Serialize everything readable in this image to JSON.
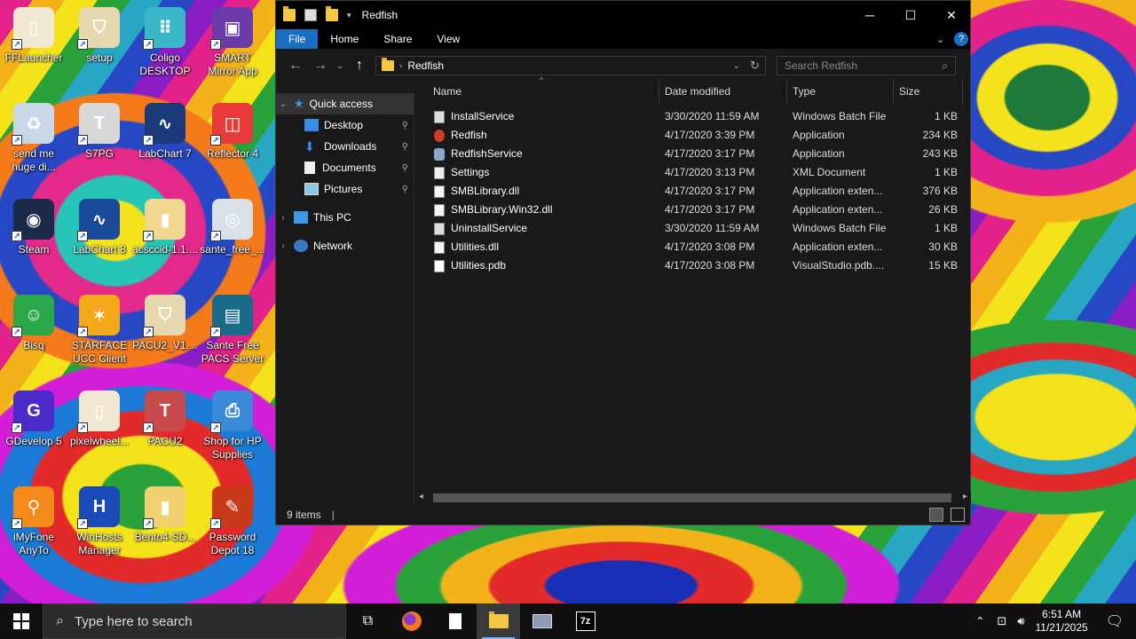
{
  "desktop": {
    "icons": [
      {
        "label": "FFLauncher",
        "color": "#f0e8d0",
        "glyph": "▯"
      },
      {
        "label": "setup",
        "color": "#e8d8b0",
        "glyph": "⛉"
      },
      {
        "label": "Coligo DESKTOP",
        "color": "#3ab8c8",
        "glyph": "⠿"
      },
      {
        "label": "SMART Mirror App",
        "color": "#6a3aa8",
        "glyph": "▣"
      },
      {
        "label": "send me huge di...",
        "color": "#c8d8e8",
        "glyph": "♻"
      },
      {
        "label": "S7PG",
        "color": "#d8d8d8",
        "glyph": "T"
      },
      {
        "label": "LabChart 7",
        "color": "#1a3a7a",
        "glyph": "∿"
      },
      {
        "label": "Reflector 4",
        "color": "#e83a3a",
        "glyph": "◫"
      },
      {
        "label": "Steam",
        "color": "#1a2a48",
        "glyph": "◉"
      },
      {
        "label": "LabChart 8",
        "color": "#1a4a9a",
        "glyph": "∿"
      },
      {
        "label": "acsccid-1.1....",
        "color": "#f0d890",
        "glyph": "▮"
      },
      {
        "label": "sante_free_...",
        "color": "#d8e0e8",
        "glyph": "◎"
      },
      {
        "label": "Bisq",
        "color": "#2aa84a",
        "glyph": "☺"
      },
      {
        "label": "STARFACE UCC Client",
        "color": "#f4a81a",
        "glyph": "✶"
      },
      {
        "label": "PACU2_V1....",
        "color": "#e8d8b0",
        "glyph": "⛉"
      },
      {
        "label": "Sante Free PACS Server",
        "color": "#1a6a8a",
        "glyph": "▤"
      },
      {
        "label": "GDevelop 5",
        "color": "#4a2ac8",
        "glyph": "G"
      },
      {
        "label": "pixelwheel...",
        "color": "#f0e8d0",
        "glyph": "▯"
      },
      {
        "label": "PACU2",
        "color": "#c84a4a",
        "glyph": "T"
      },
      {
        "label": "Shop for HP Supplies",
        "color": "#3a8ad8",
        "glyph": "⎙"
      },
      {
        "label": "iMyFone AnyTo",
        "color": "#f48a1a",
        "glyph": "⚲"
      },
      {
        "label": "WinHosts Manager",
        "color": "#1a4ab8",
        "glyph": "H"
      },
      {
        "label": "Bento4-SD...",
        "color": "#f0d070",
        "glyph": "▮"
      },
      {
        "label": "Password Depot 18",
        "color": "#c83a1a",
        "glyph": "✎"
      }
    ]
  },
  "window": {
    "title": "Redfish",
    "ribbon_tabs": [
      "File",
      "Home",
      "Share",
      "View"
    ],
    "address_path": "Redfish",
    "search_placeholder": "Search Redfish",
    "nav": {
      "quick_access": "Quick access",
      "pinned": [
        "Desktop",
        "Downloads",
        "Documents",
        "Pictures"
      ],
      "this_pc": "This PC",
      "network": "Network"
    },
    "columns": [
      "Name",
      "Date modified",
      "Type",
      "Size"
    ],
    "files": [
      {
        "name": "InstallService",
        "date": "3/30/2020 11:59 AM",
        "type": "Windows Batch File",
        "size": "1 KB",
        "icon": "batch"
      },
      {
        "name": "Redfish",
        "date": "4/17/2020 3:39 PM",
        "type": "Application",
        "size": "234 KB",
        "icon": "app"
      },
      {
        "name": "RedfishService",
        "date": "4/17/2020 3:17 PM",
        "type": "Application",
        "size": "243 KB",
        "icon": "svc"
      },
      {
        "name": "Settings",
        "date": "4/17/2020 3:13 PM",
        "type": "XML Document",
        "size": "1 KB",
        "icon": "xml"
      },
      {
        "name": "SMBLibrary.dll",
        "date": "4/17/2020 3:17 PM",
        "type": "Application exten...",
        "size": "376 KB",
        "icon": "dll"
      },
      {
        "name": "SMBLibrary.Win32.dll",
        "date": "4/17/2020 3:17 PM",
        "type": "Application exten...",
        "size": "26 KB",
        "icon": "dll"
      },
      {
        "name": "UninstallService",
        "date": "3/30/2020 11:59 AM",
        "type": "Windows Batch File",
        "size": "1 KB",
        "icon": "batch"
      },
      {
        "name": "Utilities.dll",
        "date": "4/17/2020 3:08 PM",
        "type": "Application exten...",
        "size": "30 KB",
        "icon": "dll"
      },
      {
        "name": "Utilities.pdb",
        "date": "4/17/2020 3:08 PM",
        "type": "VisualStudio.pdb....",
        "size": "15 KB",
        "icon": "pdb"
      }
    ],
    "status": "9 items"
  },
  "taskbar": {
    "search_placeholder": "Type here to search",
    "time": "6:51 AM",
    "date": "11/21/2025",
    "apps": [
      "task-view",
      "firefox",
      "notepad",
      "file-explorer",
      "recycle-app",
      "7zip"
    ]
  }
}
